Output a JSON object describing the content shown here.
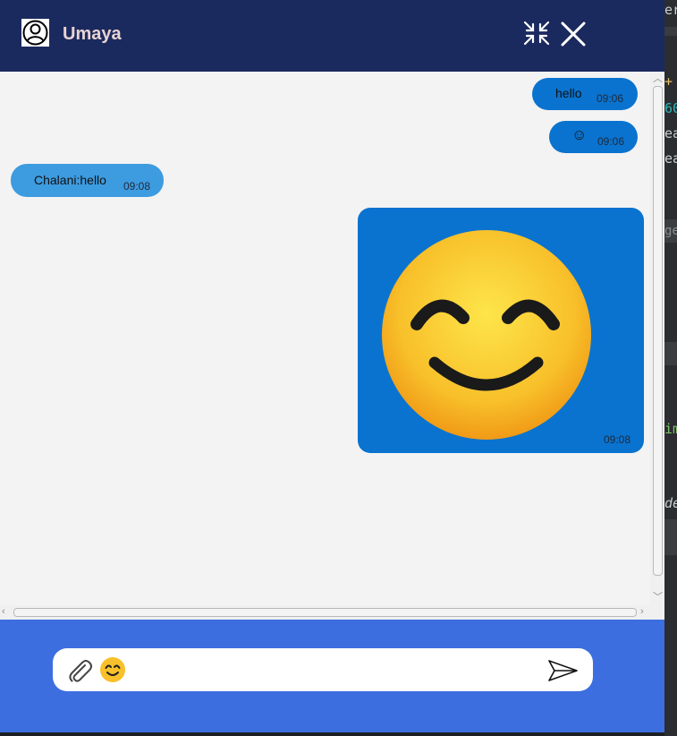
{
  "header": {
    "contact_name": "Umaya",
    "avatar_icon": "user-avatar-icon",
    "minimize_icon": "collapse-arrows-icon",
    "close_icon": "close-icon",
    "background": "#1b2a5e"
  },
  "messages": [
    {
      "sender": "me",
      "text": "hello",
      "time": "09:06",
      "color": "#0a73cf"
    },
    {
      "sender": "me",
      "text": "☺",
      "time": "09:06",
      "color": "#0a73cf"
    },
    {
      "sender": "other",
      "text": "Chalani:hello",
      "time": "09:08",
      "color": "#3d9be0"
    },
    {
      "sender": "me",
      "type": "image",
      "image_icon": "smiling-face-emoji",
      "time": "09:08",
      "color": "#0a73cf"
    }
  ],
  "composer": {
    "input_value": "",
    "attach_icon": "paperclip-icon",
    "emoji_icon": "smiling-face-emoji-icon",
    "send_icon": "send-arrow-icon",
    "background": "#3c6ee0"
  },
  "background_app": {
    "text_fragments": [
      "er",
      "+",
      "60",
      "ea",
      "ea",
      "ge",
      "im",
      "de"
    ]
  }
}
